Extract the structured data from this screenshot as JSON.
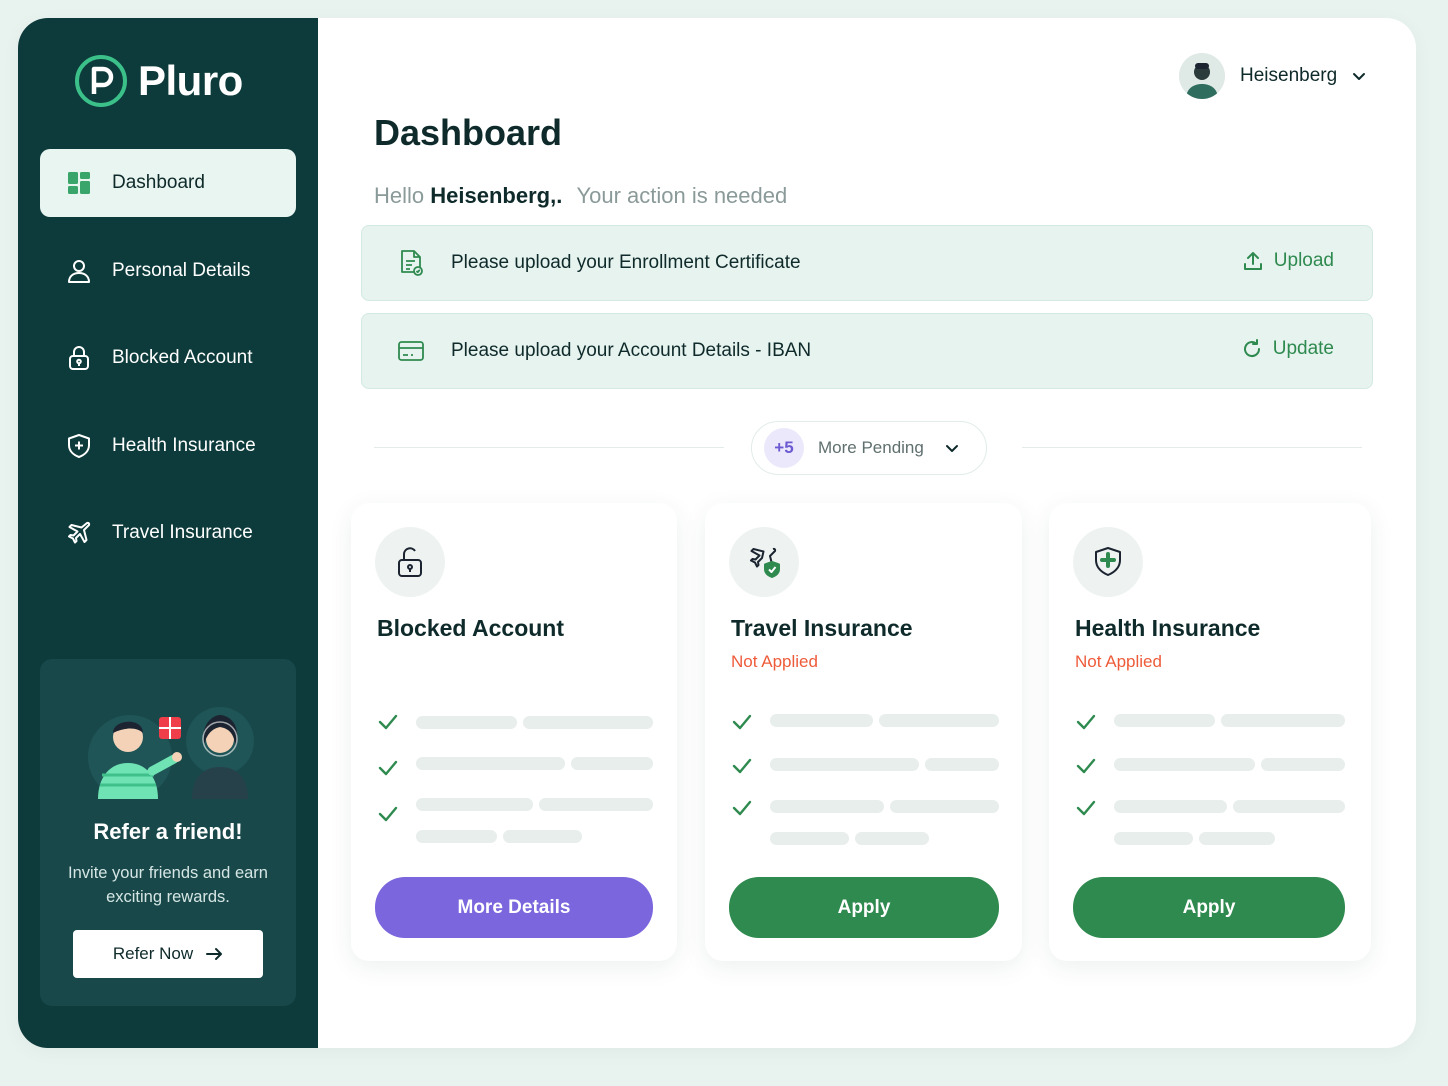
{
  "app": {
    "name": "Pluro"
  },
  "sidebar": {
    "items": [
      {
        "label": "Dashboard",
        "icon": "grid-icon",
        "active": true
      },
      {
        "label": "Personal Details",
        "icon": "user-icon"
      },
      {
        "label": "Blocked Account",
        "icon": "lock-icon"
      },
      {
        "label": "Health Insurance",
        "icon": "shield-plus-icon"
      },
      {
        "label": "Travel Insurance",
        "icon": "plane-icon"
      }
    ],
    "refer": {
      "title": "Refer a friend!",
      "text": "Invite your friends and earn exciting rewards.",
      "button": "Refer Now"
    }
  },
  "header": {
    "user_name": "Heisenberg"
  },
  "main": {
    "title": "Dashboard",
    "greeting_prefix": "Hello",
    "greeting_name": "Heisenberg,.",
    "greeting_action": "Your action is needed",
    "tasks": [
      {
        "text": "Please upload your Enrollment Certificate",
        "action": "Upload",
        "icon": "document-icon",
        "action_icon": "upload-icon"
      },
      {
        "text": "Please upload your Account Details - IBAN",
        "action": "Update",
        "icon": "card-icon",
        "action_icon": "refresh-icon"
      }
    ],
    "pending": {
      "count": "+5",
      "label": "More Pending"
    },
    "cards": [
      {
        "title": "Blocked Account",
        "status": "",
        "button": "More Details",
        "icon": "unlock-icon"
      },
      {
        "title": "Travel Insurance",
        "status": "Not Applied",
        "button": "Apply",
        "icon": "plane-shield-icon"
      },
      {
        "title": "Health Insurance",
        "status": "Not Applied",
        "button": "Apply",
        "icon": "shield-plus-icon"
      }
    ]
  },
  "colors": {
    "sidebar_bg": "#0d3a3a",
    "accent_green": "#2f8a4f",
    "accent_purple": "#7b66dd",
    "status_red": "#ee5b3a",
    "page_bg": "#e8f3ef"
  }
}
